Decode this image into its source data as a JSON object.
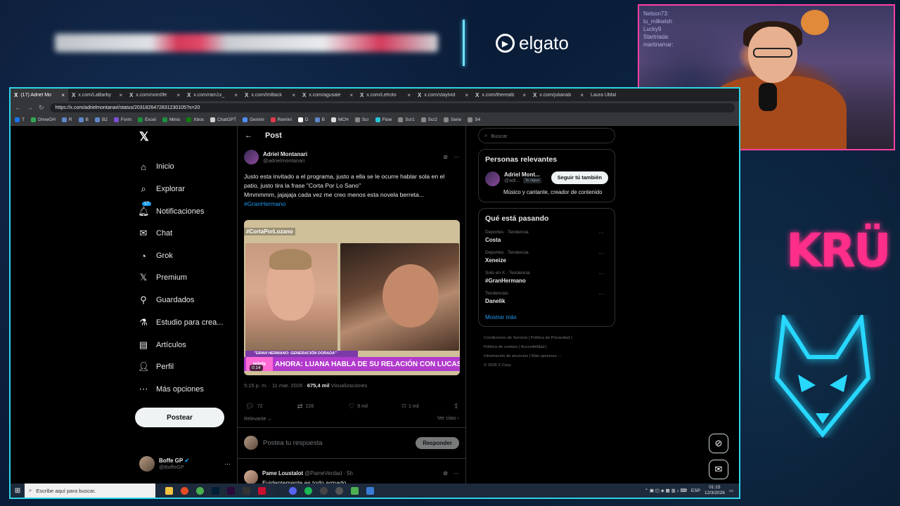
{
  "overlay": {
    "sponsor": "elgato",
    "team_logo": "KRÜ",
    "webcam_chat": [
      "Nelson73:",
      "lu_milkwish",
      "Lucky9",
      "Startriada:",
      "martinamar:"
    ]
  },
  "browser": {
    "tabs": [
      {
        "label": "(17) Adriel Mo"
      },
      {
        "label": "x.com/LaBarby"
      },
      {
        "label": "x.com/nom0fe"
      },
      {
        "label": "x.com/ram1x_"
      },
      {
        "label": "x.com/lmBack"
      },
      {
        "label": "x.com/agusale"
      },
      {
        "label": "x.com/Lefroto"
      },
      {
        "label": "x.com/staylvid"
      },
      {
        "label": "x.com/therealb"
      },
      {
        "label": "x.com/julianab"
      },
      {
        "label": "Laura Ubfal"
      }
    ],
    "url": "https://x.com/adrielmontanari/status/2031826472831230105?s=20",
    "bookmarks": [
      "T",
      "DriveGH",
      "R",
      "B",
      "B2",
      "Form",
      "Excel",
      "Minis",
      "Xbox",
      "ChatGPT",
      "Gemini",
      "Remini",
      "D",
      "B",
      "MCH",
      "Scr",
      "Flow",
      "Scr1",
      "Scr2",
      "Serie",
      "S4"
    ]
  },
  "nav": {
    "items": [
      {
        "label": "Inicio",
        "icon": "home-icon"
      },
      {
        "label": "Explorar",
        "icon": "search-icon"
      },
      {
        "label": "Notificaciones",
        "icon": "bell-icon",
        "badge": "17"
      },
      {
        "label": "Chat",
        "icon": "chat-icon"
      },
      {
        "label": "Grok",
        "icon": "grok-icon"
      },
      {
        "label": "Premium",
        "icon": "x-premium-icon"
      },
      {
        "label": "Guardados",
        "icon": "bookmark-icon"
      },
      {
        "label": "Estudio para crea...",
        "icon": "studio-icon"
      },
      {
        "label": "Artículos",
        "icon": "article-icon"
      },
      {
        "label": "Perfil",
        "icon": "profile-icon"
      },
      {
        "label": "Más opciones",
        "icon": "more-icon"
      }
    ],
    "post_button": "Postear",
    "account": {
      "name": "Boffe GP",
      "handle": "@BoffeGP"
    }
  },
  "post": {
    "header": "Post",
    "author": "Adriel Montanari",
    "handle": "@adrielmontanari",
    "text_line1": "Justo esta invitado a el programa, justo a ella se le ocurre hablar sola en el patio, justo tira la frase \"Corta Por Lo Sano\"",
    "text_line2": "Mmmmmm, jajajaja cada vez me creo menos esta novela berreta...",
    "hashtag": "#GranHermano",
    "media": {
      "tag": "#CortaPorLozano",
      "banner_small": "\"GRAN HERMANO: GENERACIÓN DORADA\"",
      "banner_large": "AHORA: LUANA HABLA DE SU RELACIÓN CON LUCAS, SU EX",
      "logo": "telefe",
      "duration": "0:14"
    },
    "time": "5:15 p. m. · 11 mar. 2026 ·",
    "views": "675,4 mil",
    "views_label": "Visualizaciones",
    "replies": "72",
    "reposts": "226",
    "likes": "9 mil",
    "bookmarks": "1 mil",
    "relevance": "Relevante",
    "quotes": "Ver citas",
    "reply_placeholder": "Postea tu respuesta",
    "reply_button": "Responder"
  },
  "reply": {
    "author": "Pame Loustalot",
    "handle": "@PameVerdad · 5h",
    "text": "Evidentemente es todo armado"
  },
  "sidebar": {
    "search_placeholder": "Buscar",
    "relevant_title": "Personas relevantes",
    "person": {
      "name": "Adriel Mont...",
      "handle": "@adr...",
      "follows_you": "Te sigue",
      "follow_button": "Seguir tú también",
      "bio": "Músico y cantante, creador de contenido"
    },
    "trends_title": "Qué está pasando",
    "trends": [
      {
        "meta": "Deportes · Tendencia",
        "name": "Costa"
      },
      {
        "meta": "Deportes · Tendencia",
        "name": "Xeneize"
      },
      {
        "meta": "Solo en X · Tendencia",
        "name": "#GranHermano"
      },
      {
        "meta": "Tendencias",
        "name": "Danelik"
      }
    ],
    "show_more": "Mostrar más",
    "footer1": "Condiciones de Servicio  |  Política de Privacidad  |",
    "footer2": "Política de cookies  |  Accesibilidad  |",
    "footer3": "Información de anuncios  |  Más opciones ···",
    "footer4": "© 2026 X Corp."
  },
  "taskbar": {
    "search_placeholder": "Escribe aquí para buscar.",
    "lang": "ESP",
    "time": "01:15",
    "date": "12/3/2026"
  }
}
